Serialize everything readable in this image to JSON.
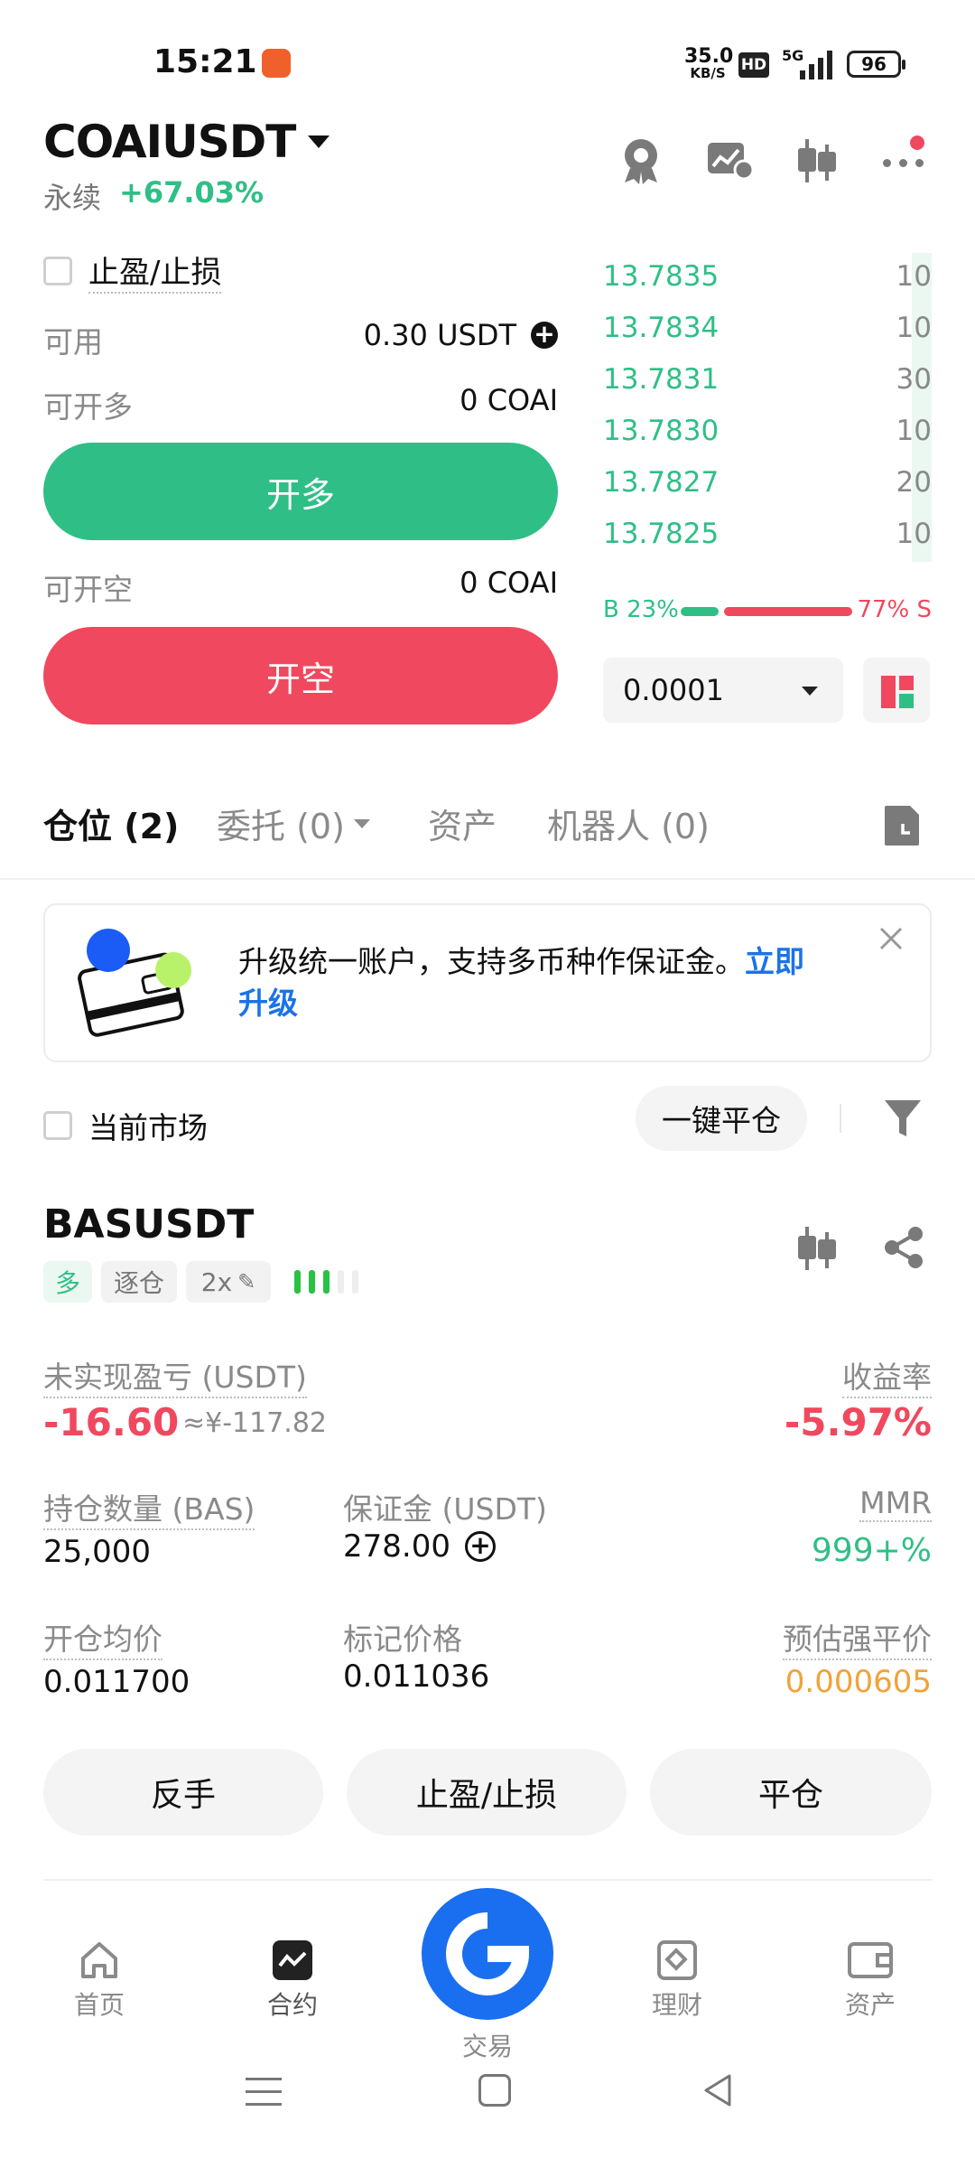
{
  "status_bar": {
    "time": "15:21",
    "net_speed_value": "35.0",
    "net_speed_unit": "KB/S",
    "hd": "HD",
    "signal_type": "5G",
    "battery": "96"
  },
  "header": {
    "symbol": "COAIUSDT",
    "type_label": "永续",
    "change": "+67.03%"
  },
  "trade": {
    "tp_sl_label": "止盈/止损",
    "available_label": "可用",
    "available_value": "0.30 USDT",
    "can_long_label": "可开多",
    "can_long_value": "0 COAI",
    "long_button": "开多",
    "can_short_label": "可开空",
    "can_short_value": "0 COAI",
    "short_button": "开空"
  },
  "orderbook": {
    "rows": [
      {
        "price": "13.7835",
        "qty": "10",
        "depth": 0.06
      },
      {
        "price": "13.7834",
        "qty": "10",
        "depth": 0.06
      },
      {
        "price": "13.7831",
        "qty": "30",
        "depth": 0.06
      },
      {
        "price": "13.7830",
        "qty": "10",
        "depth": 0.06
      },
      {
        "price": "13.7827",
        "qty": "20",
        "depth": 0.06
      },
      {
        "price": "13.7825",
        "qty": "10",
        "depth": 0.06
      }
    ],
    "buy_ratio_label": "B 23%",
    "sell_ratio_label": "77% S",
    "buy_ratio": 0.23,
    "precision": "0.0001"
  },
  "tabs": {
    "positions": "仓位 (2)",
    "orders": "委托 (0)",
    "assets": "资产",
    "bots": "机器人 (0)"
  },
  "banner": {
    "text": "升级统一账户，支持多币种作保证金。",
    "link_part1": "立即",
    "link_part2": "升级"
  },
  "filter": {
    "current_market_label": "当前市场",
    "close_all_label": "一键平仓"
  },
  "position": {
    "symbol": "BASUSDT",
    "side": "多",
    "margin_mode": "逐仓",
    "leverage": "2x",
    "unrealized_pnl_label": "未实现盈亏 (USDT)",
    "unrealized_pnl": "-16.60",
    "unrealized_pnl_cny": "≈¥-117.82",
    "roe_label": "收益率",
    "roe": "-5.97%",
    "qty_label": "持仓数量 (BAS)",
    "qty": "25,000",
    "margin_label": "保证金 (USDT)",
    "margin": "278.00",
    "mmr_label": "MMR",
    "mmr": "999+%",
    "entry_label": "开仓均价",
    "entry": "0.011700",
    "mark_label": "标记价格",
    "mark": "0.011036",
    "liq_label": "预估强平价",
    "liq": "0.000605",
    "btn_reverse": "反手",
    "btn_tpsl": "止盈/止损",
    "btn_close": "平仓"
  },
  "bottom_nav": {
    "home": "首页",
    "contract": "合约",
    "trade": "交易",
    "finance": "理财",
    "assets": "资产"
  },
  "colors": {
    "green": "#2fbf86",
    "red": "#f0485e",
    "blue": "#1a6ff0",
    "orange": "#f2a23a"
  }
}
